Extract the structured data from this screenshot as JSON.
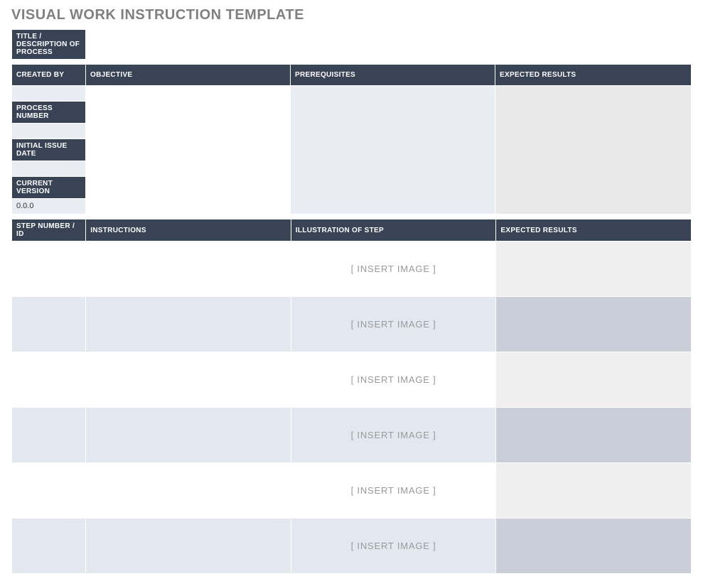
{
  "page": {
    "title": "VISUAL WORK INSTRUCTION TEMPLATE"
  },
  "title_block": {
    "label": "TITLE / DESCRIPTION OF PROCESS",
    "value": ""
  },
  "meta_headers": {
    "created_by": "CREATED BY",
    "objective": "OBJECTIVE",
    "prerequisites": "PREREQUISITES",
    "expected_results": "EXPECTED RESULTS",
    "process_number": "PROCESS NUMBER",
    "initial_issue_date": "INITIAL ISSUE DATE",
    "current_version": "CURRENT VERSION"
  },
  "meta_values": {
    "created_by": "",
    "process_number": "",
    "initial_issue_date": "",
    "current_version": "0.0.0",
    "objective": "",
    "prerequisites": "",
    "expected_results": ""
  },
  "steps_headers": {
    "step_number": "STEP NUMBER / ID",
    "instructions": "INSTRUCTIONS",
    "illustration": "ILLUSTRATION OF STEP",
    "expected_results": "EXPECTED RESULTS"
  },
  "steps": [
    {
      "id": "",
      "instructions": "",
      "illustration_placeholder": "[ INSERT IMAGE ]",
      "expected": ""
    },
    {
      "id": "",
      "instructions": "",
      "illustration_placeholder": "[ INSERT IMAGE ]",
      "expected": ""
    },
    {
      "id": "",
      "instructions": "",
      "illustration_placeholder": "[ INSERT IMAGE ]",
      "expected": ""
    },
    {
      "id": "",
      "instructions": "",
      "illustration_placeholder": "[ INSERT IMAGE ]",
      "expected": ""
    },
    {
      "id": "",
      "instructions": "",
      "illustration_placeholder": "[ INSERT IMAGE ]",
      "expected": ""
    },
    {
      "id": "",
      "instructions": "",
      "illustration_placeholder": "[ INSERT IMAGE ]",
      "expected": ""
    }
  ]
}
